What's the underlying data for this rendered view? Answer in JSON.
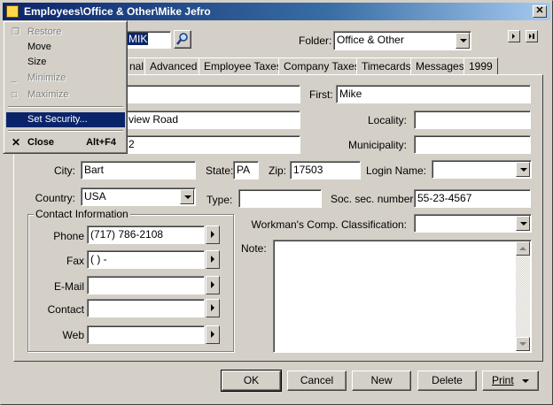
{
  "window": {
    "title": "Employees\\Office & Other\\Mike Jefro",
    "close_glyph": "✕"
  },
  "header": {
    "id_value": "MIK",
    "folder_label": "Folder:",
    "folder_value": "Office & Other"
  },
  "tabs": [
    {
      "label": "nal"
    },
    {
      "label": "Advanced"
    },
    {
      "label": "Employee Taxes"
    },
    {
      "label": "Company Taxes"
    },
    {
      "label": "Timecards"
    },
    {
      "label": "Messages"
    },
    {
      "label": "1999"
    }
  ],
  "form": {
    "last_value": "",
    "first_label": "First:",
    "first_value": "Mike",
    "address1_value": "view Road",
    "locality_label": "Locality:",
    "locality_value": "",
    "address2_value": "2",
    "municipality_label": "Municipality:",
    "municipality_value": "",
    "city_label": "City:",
    "city_value": "Bart",
    "state_label": "State:",
    "state_value": "PA",
    "zip_label": "Zip:",
    "zip_value": "17503",
    "login_label": "Login Name:",
    "login_value": "",
    "country_label": "Country:",
    "country_value": "USA",
    "type_label": "Type:",
    "type_value": "",
    "ssn_label": "Soc. sec. number:",
    "ssn_value": "55-23-4567",
    "workcomp_label": "Workman's Comp. Classification:",
    "workcomp_value": "",
    "note_label": "Note:",
    "note_value": ""
  },
  "contact": {
    "legend": "Contact Information",
    "phone_label": "Phone",
    "phone_value": "(717) 786-2108",
    "fax_label": "Fax",
    "fax_value": "(   )    -",
    "email_label": "E-Mail",
    "email_value": "",
    "contact_label": "Contact",
    "contact_value": "",
    "web_label": "Web",
    "web_value": ""
  },
  "buttons": {
    "ok": "OK",
    "cancel": "Cancel",
    "new": "New",
    "delete": "Delete",
    "print": "Print"
  },
  "sysmenu": {
    "restore": "Restore",
    "move": "Move",
    "size": "Size",
    "minimize": "Minimize",
    "maximize": "Maximize",
    "set_security": "Set Security...",
    "close": "Close",
    "close_shortcut": "Alt+F4"
  },
  "colors": {
    "face": "#d4d0c8",
    "title_active": "#0a246a",
    "highlight": "#0a246a"
  }
}
